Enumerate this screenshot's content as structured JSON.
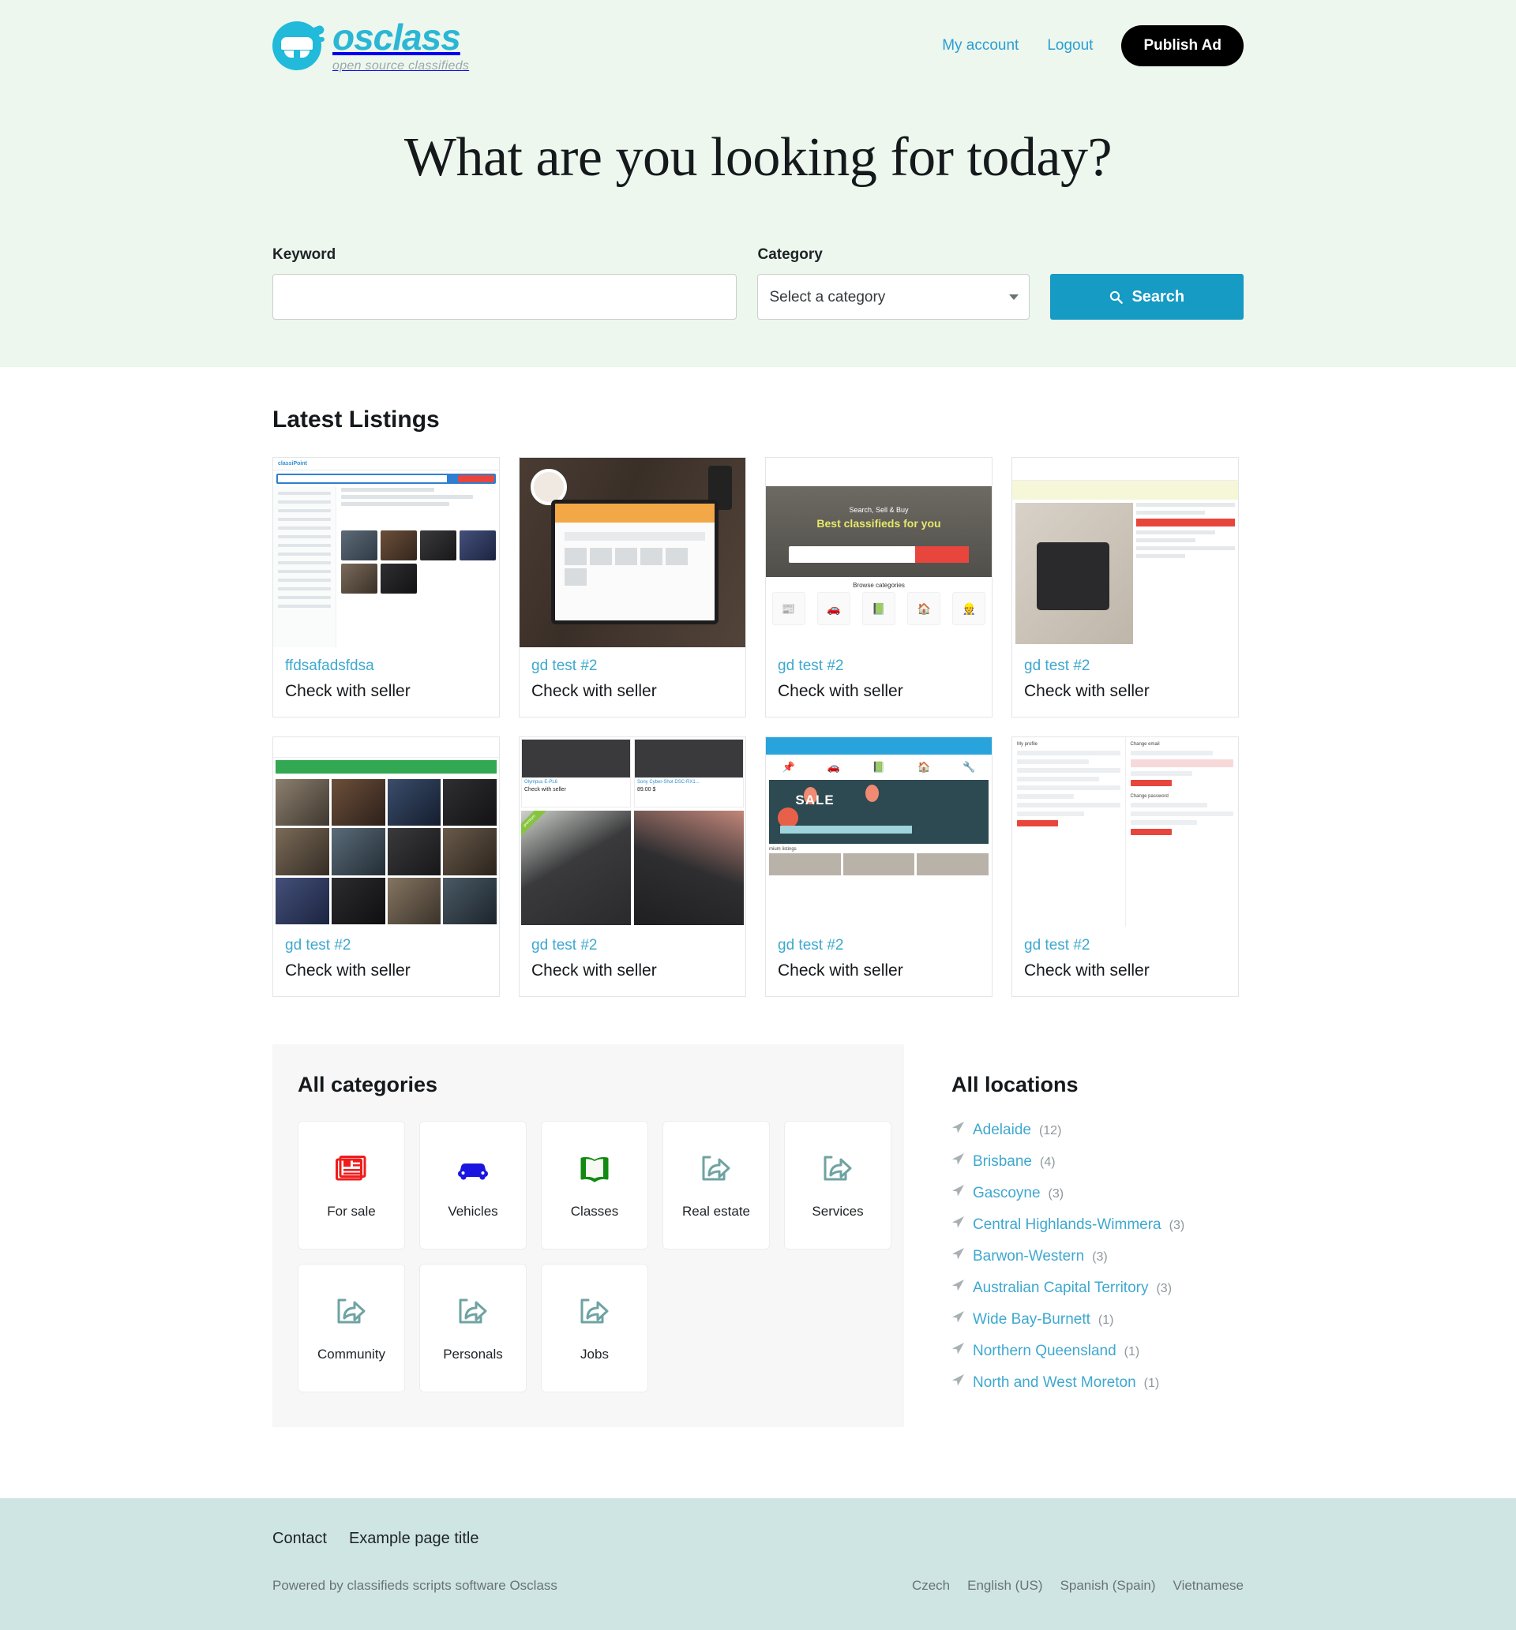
{
  "brand": {
    "name": "osclass",
    "tagline": "open source classifieds",
    "logo_icon": "osclass-car-logo",
    "accent_color": "#2bb6d6"
  },
  "header": {
    "nav": [
      {
        "label": "My account",
        "name": "my-account"
      },
      {
        "label": "Logout",
        "name": "logout"
      }
    ],
    "publish_button": "Publish Ad"
  },
  "hero": {
    "title": "What are you looking for today?",
    "background_color": "#edf7ed"
  },
  "search": {
    "keyword_label": "Keyword",
    "keyword_value": "",
    "keyword_placeholder": "",
    "category_label": "Category",
    "category_selected": "Select a category",
    "category_options": [
      "Select a category"
    ],
    "search_button": "Search",
    "search_icon": "magnifier-icon",
    "button_color": "#159bc4"
  },
  "listings": {
    "title": "Latest Listings",
    "cards": [
      {
        "title": "ffdsafadsfdsa",
        "price": "Check with seller",
        "thumb": "screenshot-search-results"
      },
      {
        "title": "gd test #2",
        "price": "Check with seller",
        "thumb": "photo-tablet-on-desk"
      },
      {
        "title": "gd test #2",
        "price": "Check with seller",
        "thumb": "screenshot-homepage-hero"
      },
      {
        "title": "gd test #2",
        "price": "Check with seller",
        "thumb": "screenshot-listing-detail"
      },
      {
        "title": "gd test #2",
        "price": "Check with seller",
        "thumb": "screenshot-seller-items"
      },
      {
        "title": "gd test #2",
        "price": "Check with seller",
        "thumb": "screenshot-camera-listings"
      },
      {
        "title": "gd test #2",
        "price": "Check with seller",
        "thumb": "screenshot-fantastic-sale"
      },
      {
        "title": "gd test #2",
        "price": "Check with seller",
        "thumb": "screenshot-my-profile"
      }
    ],
    "thumb_texts": {
      "card3_hero_line1": "Search, Sell & Buy",
      "card3_hero_line2": "Best classifieds for you",
      "card3_browse": "Browse categories",
      "card6_item1_title": "Olympus E-PL6",
      "card6_item1_price": "Check with seller",
      "card6_item2_title": "Sony Cyber-Shot DSC-RX1...",
      "card6_item2_price": "89.00 $",
      "card6_ribbon": "premium",
      "card7_sale": "SALE",
      "card7_premium": "mium listings"
    }
  },
  "categories": {
    "title": "All categories",
    "items": [
      {
        "label": "For sale",
        "icon": "newspaper-icon",
        "glyph": "📰"
      },
      {
        "label": "Vehicles",
        "icon": "car-icon",
        "glyph": "🚘"
      },
      {
        "label": "Classes",
        "icon": "open-book-icon",
        "glyph": "📖"
      },
      {
        "label": "Real estate",
        "icon": "broken-image-share-icon",
        "glyph": ""
      },
      {
        "label": "Services",
        "icon": "broken-image-share-icon",
        "glyph": ""
      },
      {
        "label": "Community",
        "icon": "broken-image-share-icon",
        "glyph": ""
      },
      {
        "label": "Personals",
        "icon": "broken-image-share-icon",
        "glyph": ""
      },
      {
        "label": "Jobs",
        "icon": "broken-image-share-icon",
        "glyph": ""
      }
    ]
  },
  "locations": {
    "title": "All locations",
    "pin_icon": "paper-plane-icon",
    "items": [
      {
        "name": "Adelaide",
        "count": "(12)"
      },
      {
        "name": "Brisbane",
        "count": "(4)"
      },
      {
        "name": "Gascoyne",
        "count": "(3)"
      },
      {
        "name": "Central Highlands-Wimmera",
        "count": "(3)"
      },
      {
        "name": "Barwon-Western",
        "count": "(3)"
      },
      {
        "name": "Australian Capital Territory",
        "count": "(3)"
      },
      {
        "name": "Wide Bay-Burnett",
        "count": "(1)"
      },
      {
        "name": "Northern Queensland",
        "count": "(1)"
      },
      {
        "name": "North and West Moreton",
        "count": "(1)"
      }
    ]
  },
  "footer": {
    "links": [
      {
        "label": "Contact",
        "name": "contact"
      },
      {
        "label": "Example page title",
        "name": "example-page-title"
      }
    ],
    "powered_by": "Powered by classifieds scripts software Osclass",
    "languages": [
      {
        "label": "Czech"
      },
      {
        "label": "English (US)"
      },
      {
        "label": "Spanish (Spain)"
      },
      {
        "label": "Vietnamese"
      }
    ],
    "background_color": "#cfe5e4"
  }
}
